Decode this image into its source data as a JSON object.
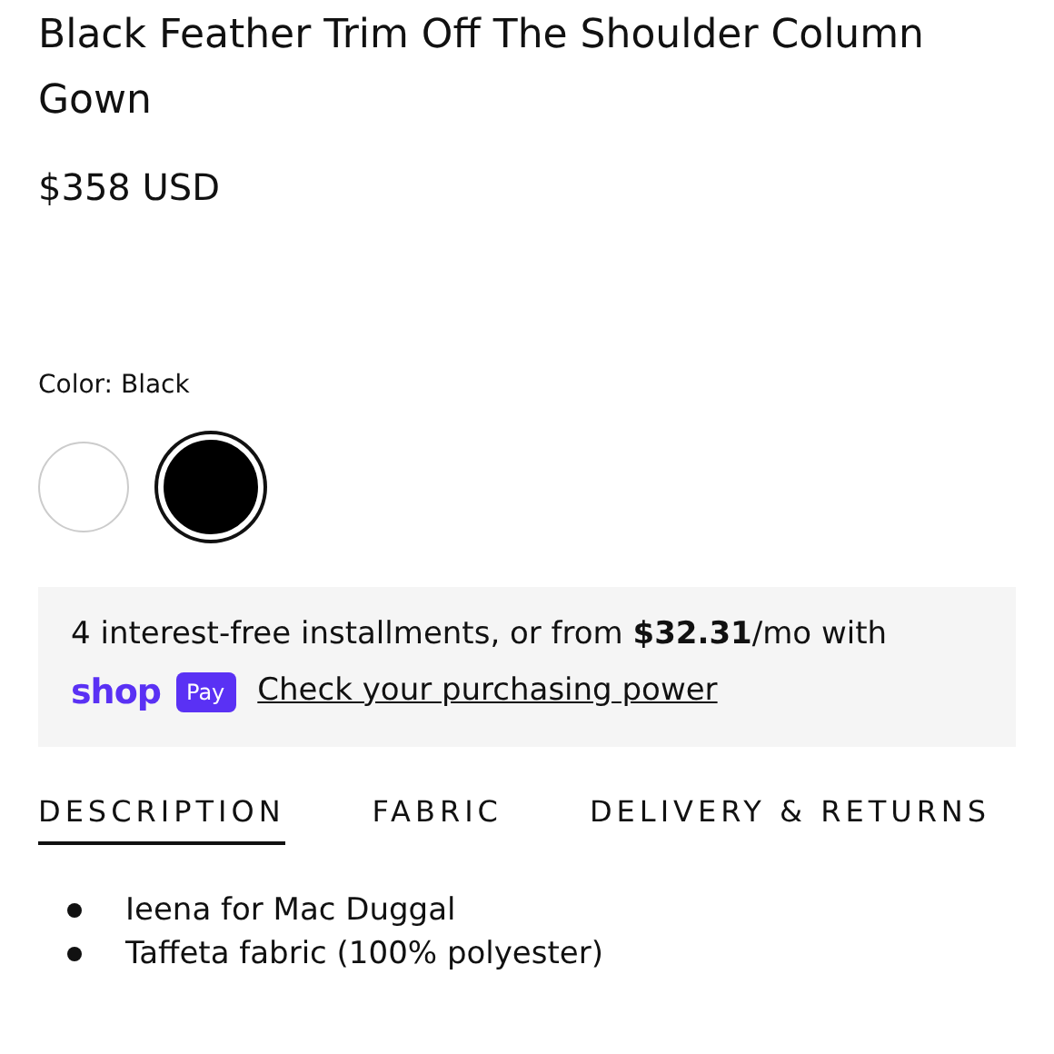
{
  "product": {
    "title": "Black Feather Trim Off The Shoulder Column Gown",
    "price": "$358 USD"
  },
  "color": {
    "label": "Color: Black",
    "swatches": [
      {
        "color": "#ffffff",
        "selected": false
      },
      {
        "color": "#000000",
        "selected": true
      }
    ]
  },
  "installments": {
    "text": "4 interest-free installments, or from **$32.31**/mo with",
    "logo_word": "shop",
    "logo_badge": "Pay",
    "link": "Check your purchasing power"
  },
  "tabs": [
    {
      "label": "DESCRIPTION",
      "selected": true
    },
    {
      "label": "FABRIC",
      "selected": false
    },
    {
      "label": "DELIVERY & RETURNS",
      "selected": false
    }
  ],
  "bullets": [
    "Ieena for Mac Duggal",
    "Taffeta fabric (100% polyester)"
  ]
}
